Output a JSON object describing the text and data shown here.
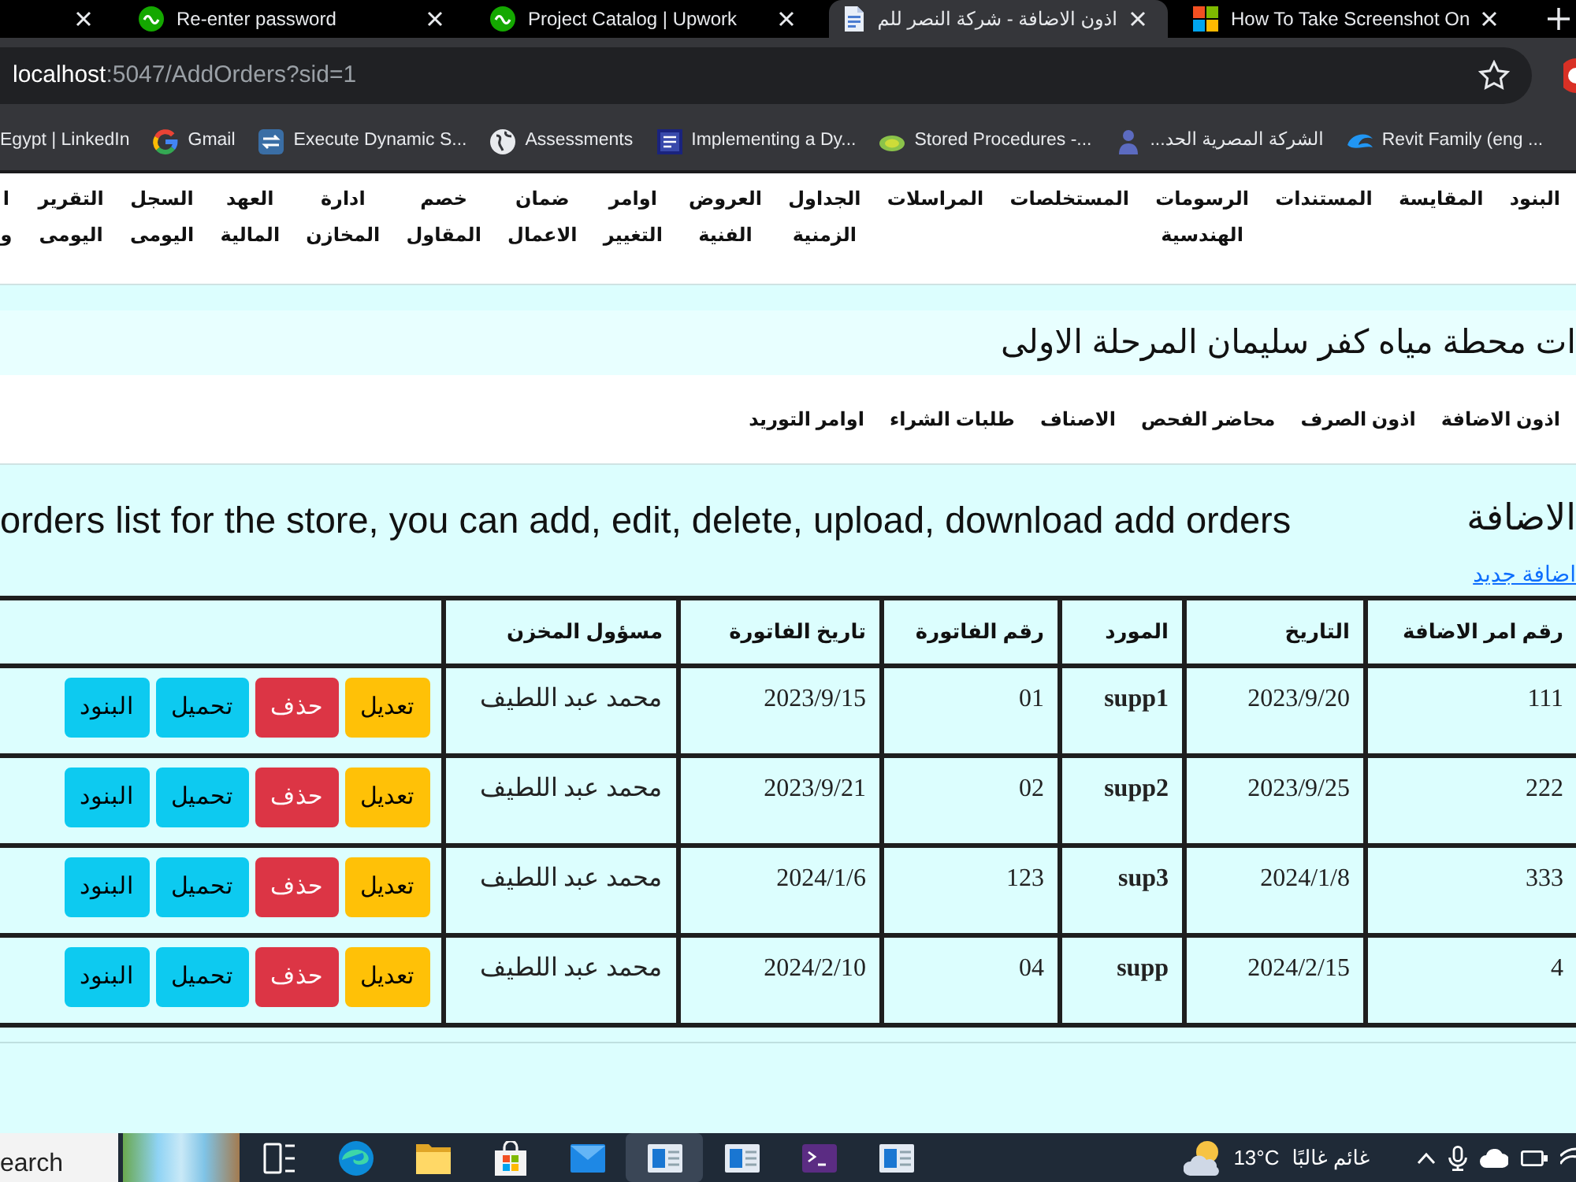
{
  "browser": {
    "tabs": [
      {
        "title": "How To Take Screenshot On",
        "kind": "squares",
        "selected": false
      },
      {
        "title": "اذون الاضافة - شركة النصر للم",
        "kind": "document",
        "selected": true
      },
      {
        "title": "Project Catalog | Upwork",
        "kind": "circle",
        "selected": false
      },
      {
        "title": "Re-enter password",
        "kind": "circle",
        "selected": false
      },
      {
        "kind": "cut",
        "selected": false
      }
    ],
    "address": {
      "host": "localhost",
      "path": ":5047/AddOrders?sid=1"
    },
    "bookmarks": [
      {
        "title": "Revit Family (eng ...",
        "kind": "swirl"
      },
      {
        "title": "الشركة المصرية الحد...",
        "kind": "person"
      },
      {
        "title": "Stored Procedures -...",
        "kind": "leaf"
      },
      {
        "title": "Implementing a Dy...",
        "kind": "square"
      },
      {
        "title": "Assessments",
        "kind": "globe"
      },
      {
        "title": "Execute Dynamic S...",
        "kind": "arrows"
      },
      {
        "title": "Gmail",
        "kind": "ring"
      },
      {
        "title": "Egypt | LinkedIn",
        "kind": "none"
      }
    ]
  },
  "site_nav": [
    "البنود",
    "المقايسة",
    "المستندات",
    "الرسومات الهندسية",
    "المستخلصات",
    "المراسلات",
    "الجداول الزمنية",
    "العروض الفنية",
    "اوامر التغيير",
    "ضمان الاعمال",
    "خصم المقاول",
    "ادارة المخازن",
    "العهد المالية",
    "السجل اليومى",
    "التقرير اليومى",
    "ا و"
  ],
  "project_title": "ات محطة مياه كفر سليمان المرحلة الاولى",
  "sub_nav": [
    "اذون الاضافة",
    "اذون الصرف",
    "محاضر الفحص",
    "الاصناف",
    "طلبات الشراء",
    "اوامر التوريد"
  ],
  "page": {
    "heading": "الاضافة",
    "description": "orders list for the store, you can add, edit, delete, upload, download add orders",
    "new_link": "اضافة جديد"
  },
  "table": {
    "columns": [
      {
        "label": "رقم امر الاضافة",
        "bold_values": false
      },
      {
        "label": "التاريخ",
        "bold_values": false
      },
      {
        "label": "المورد",
        "bold_values": true
      },
      {
        "label": "رقم الفاتورة",
        "bold_values": false
      },
      {
        "label": "تاريخ الفاتورة",
        "bold_values": false
      },
      {
        "label": "مسؤول المخزن",
        "bold_values": false
      }
    ],
    "rows": [
      {
        "cells": [
          "111",
          "2023/9/20",
          "supp1",
          "01",
          "2023/9/15",
          "محمد عبد اللطيف"
        ],
        "actions": [
          {
            "label": "تعديل",
            "kind": "edit"
          },
          {
            "label": "حذف",
            "kind": "delete"
          },
          {
            "label": "تحميل",
            "kind": "download"
          },
          {
            "label": "البنود",
            "kind": "items"
          }
        ]
      },
      {
        "cells": [
          "222",
          "2023/9/25",
          "supp2",
          "02",
          "2023/9/21",
          "محمد عبد اللطيف"
        ],
        "actions": [
          {
            "label": "تعديل",
            "kind": "edit"
          },
          {
            "label": "حذف",
            "kind": "delete"
          },
          {
            "label": "تحميل",
            "kind": "download"
          },
          {
            "label": "البنود",
            "kind": "items"
          }
        ]
      },
      {
        "cells": [
          "333",
          "2024/1/8",
          "sup3",
          "123",
          "2024/1/6",
          "محمد عبد اللطيف"
        ],
        "actions": [
          {
            "label": "تعديل",
            "kind": "edit"
          },
          {
            "label": "حذف",
            "kind": "delete"
          },
          {
            "label": "تحميل",
            "kind": "download"
          },
          {
            "label": "البنود",
            "kind": "items"
          }
        ]
      },
      {
        "cells": [
          "4",
          "2024/2/15",
          "supp",
          "04",
          "2024/2/10",
          "محمد عبد اللطيف"
        ],
        "actions": [
          {
            "label": "تعديل",
            "kind": "edit"
          },
          {
            "label": "حذف",
            "kind": "delete"
          },
          {
            "label": "تحميل",
            "kind": "download"
          },
          {
            "label": "البنود",
            "kind": "items"
          }
        ]
      }
    ]
  },
  "taskbar": {
    "search": {
      "placeholder": "earch"
    },
    "apps": [
      {
        "kind": "taskview",
        "selected": false
      },
      {
        "kind": "browser",
        "selected": false
      },
      {
        "kind": "folder",
        "selected": false
      },
      {
        "kind": "store",
        "selected": false
      },
      {
        "kind": "mail",
        "selected": false
      },
      {
        "kind": "window",
        "selected": true
      },
      {
        "kind": "window",
        "selected": false
      },
      {
        "kind": "terminal",
        "selected": false
      },
      {
        "kind": "window",
        "selected": false
      }
    ],
    "weather": {
      "temperature": "13°C",
      "condition": "غائم غالبًا"
    }
  }
}
